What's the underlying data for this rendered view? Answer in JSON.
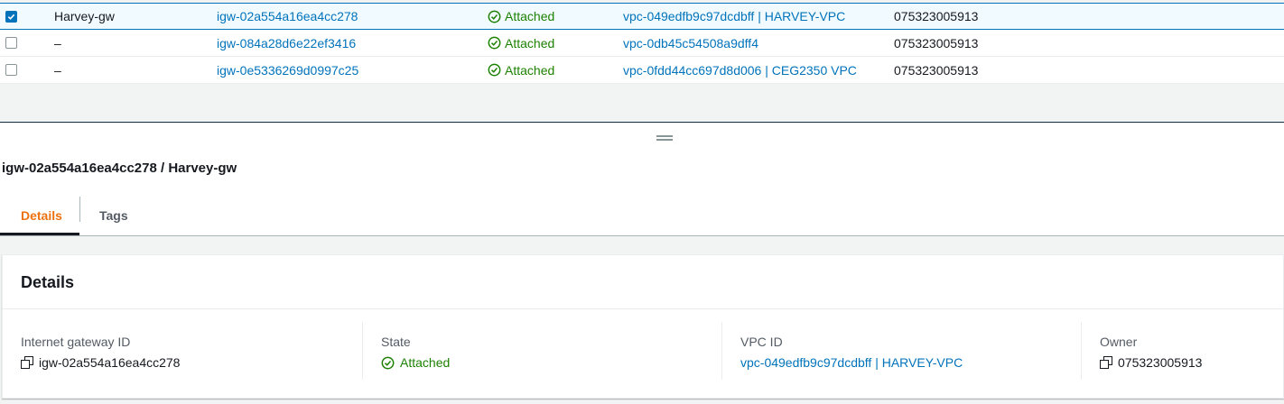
{
  "table": {
    "rows": [
      {
        "name": "Harvey-gw",
        "igw_id": "igw-02a554a16ea4cc278",
        "state": "Attached",
        "vpc": "vpc-049edfb9c97dcdbff | HARVEY-VPC",
        "owner": "075323005913",
        "selected": true
      },
      {
        "name": "–",
        "igw_id": "igw-084a28d6e22ef3416",
        "state": "Attached",
        "vpc": "vpc-0db45c54508a9dff4",
        "owner": "075323005913",
        "selected": false
      },
      {
        "name": "–",
        "igw_id": "igw-0e5336269d0997c25",
        "state": "Attached",
        "vpc": "vpc-0fdd44cc697d8d006 | CEG2350 VPC",
        "owner": "075323005913",
        "selected": false
      }
    ]
  },
  "detail": {
    "heading": "igw-02a554a16ea4cc278 / Harvey-gw",
    "tabs": [
      "Details",
      "Tags"
    ],
    "active_tab": "Details",
    "panel_title": "Details",
    "fields": {
      "igw_label": "Internet gateway ID",
      "igw_value": "igw-02a554a16ea4cc278",
      "state_label": "State",
      "state_value": "Attached",
      "vpc_label": "VPC ID",
      "vpc_value": "vpc-049edfb9c97dcdbff | HARVEY-VPC",
      "owner_label": "Owner",
      "owner_value": "075323005913"
    }
  },
  "icons": {
    "status_ok": "check-circle-icon",
    "copy": "copy-icon",
    "checkbox": "checkbox-icon",
    "resize": "drag-handle-icon"
  },
  "colors": {
    "link": "#0073bb",
    "success": "#1d8102",
    "active_tab": "#ec7211",
    "selected_row": "#f1faff"
  }
}
